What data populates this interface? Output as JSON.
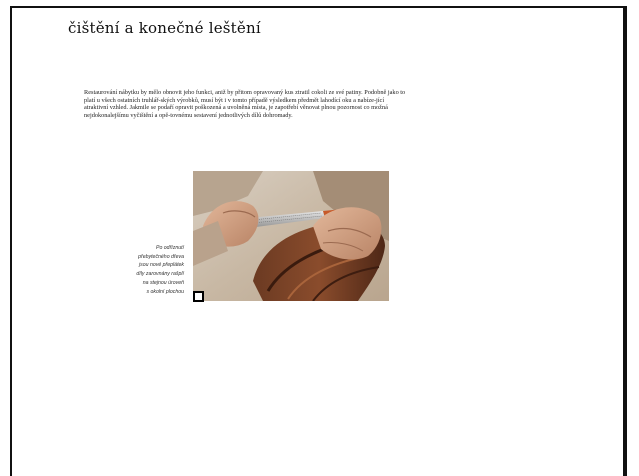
{
  "document": {
    "title": "čištění a konečné leštění",
    "body": "Restaurování nábytku by mělo obnovit jeho funkci, aniž by přitom opravovaný kus ztratil cokoli ze své patiny. Podobně jako to platí u všech ostatních truhlář-ských výrobků, musí být i v tomto případě výsledkem předmět lahodící oku a nabíze-jící atraktivní vzhled. Jakmile se podaří opravit poškozená a uvolněná místa, je zapotřebí věnovat plnou pozornost co možná nejdokonalejšímu vyčištění a opě-tovnému sestavení jednotlivých dílů dohromady.",
    "caption_lines": [
      "Po odříznutí",
      "přebytečného dřeva",
      "jsou nové přeplátek",
      "díly zarovnány rašplí",
      "na stejnou úroveň",
      "s okolní plochou"
    ]
  }
}
